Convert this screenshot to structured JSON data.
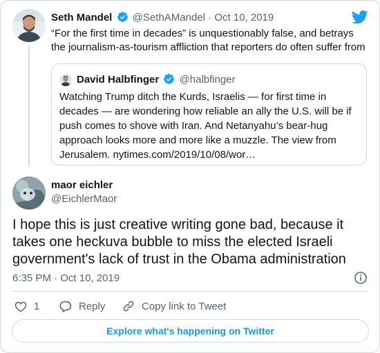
{
  "parent_tweet": {
    "author_name": "Seth Mandel",
    "handle": "@SethAMandel",
    "separator": "·",
    "date": "Oct 10, 2019",
    "text": "“For the first time in decades” is unquestionably false, and betrays the journalism-as-tourism affliction that reporters do often suffer from"
  },
  "quoted_tweet": {
    "author_name": "David Halbfinger",
    "handle": "@halbfinger",
    "text": "Watching Trump ditch the Kurds, Israelis — for first time in decades — are wondering how reliable an ally the U.S. will be if push comes to shove with Iran. And Netanyahu’s bear-hug approach looks more and more like a muzzle. The view from Jerusalem. nytimes.com/2019/10/08/wor…"
  },
  "main_tweet": {
    "author_name": "maor eichler",
    "handle": "@EichlerMaor",
    "text": "I hope this is just creative writing gone bad, because it takes one heckuva bubble to miss the elected Israeli government's lack of trust in the Obama administration",
    "time": "6:35 PM",
    "separator": "·",
    "date": "Oct 10, 2019"
  },
  "actions": {
    "like_count": "1",
    "reply_label": "Reply",
    "copy_link_label": "Copy link to Tweet"
  },
  "explore_label": "Explore what's happening on Twitter",
  "colors": {
    "twitter_blue": "#1da1f2",
    "link_blue": "#1b95e0",
    "muted_text": "#536471",
    "border": "#cfd9de"
  }
}
